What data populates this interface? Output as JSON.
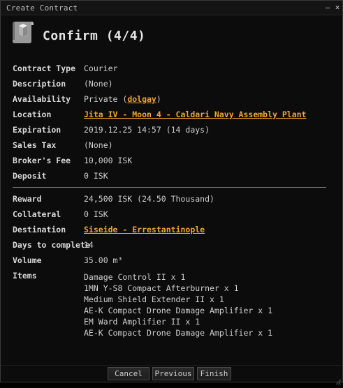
{
  "window": {
    "title": "Create Contract",
    "minimize_glyph": "–",
    "close_glyph": "×"
  },
  "header": {
    "title": "Confirm (4/4)",
    "icon": "contract-scroll-icon"
  },
  "details": {
    "contract_type": {
      "label": "Contract Type",
      "value": "Courier"
    },
    "description": {
      "label": "Description",
      "value": "(None)"
    },
    "availability": {
      "label": "Availability",
      "prefix": "Private (",
      "link": "dolgay",
      "suffix": ")"
    },
    "location": {
      "label": "Location",
      "link": "Jita IV - Moon 4 - Caldari Navy Assembly Plant"
    },
    "expiration": {
      "label": "Expiration",
      "value": "2019.12.25 14:57 (14 days)"
    },
    "sales_tax": {
      "label": "Sales Tax",
      "value": "(None)"
    },
    "brokers_fee": {
      "label": "Broker's Fee",
      "value": "10,000 ISK"
    },
    "deposit": {
      "label": "Deposit",
      "value": "0 ISK"
    },
    "reward": {
      "label": "Reward",
      "value": "24,500 ISK (24.50 Thousand)"
    },
    "collateral": {
      "label": "Collateral",
      "value": "0 ISK"
    },
    "destination": {
      "label": "Destination",
      "link": "Siseide - Errestantinople"
    },
    "days_to_complete": {
      "label": "Days to complete",
      "value": "14"
    },
    "volume": {
      "label": "Volume",
      "value": "35.00 m³"
    },
    "items": {
      "label": "Items",
      "list": [
        "Damage Control II x 1",
        "1MN Y-S8 Compact Afterburner x 1",
        "Medium Shield Extender II x 1",
        "AE-K Compact Drone Damage Amplifier x 1",
        "EM Ward Amplifier II x 1",
        "AE-K Compact Drone Damage Amplifier x 1"
      ]
    }
  },
  "buttons": {
    "cancel": "Cancel",
    "previous": "Previous",
    "finish": "Finish"
  },
  "colors": {
    "link": "#f2a52b",
    "background": "#0c0c0c",
    "text": "#cfcfcf"
  }
}
